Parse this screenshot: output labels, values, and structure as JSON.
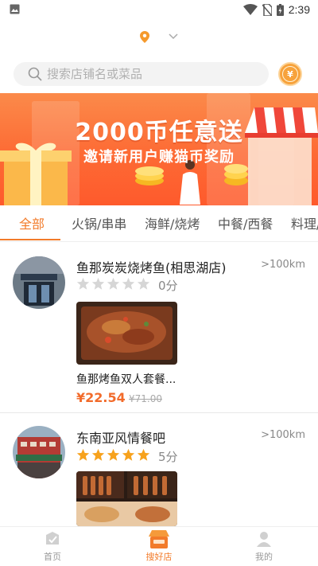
{
  "status_bar": {
    "time": "2:39"
  },
  "location": {
    "name": ""
  },
  "search": {
    "placeholder": "搜索店铺名或菜品",
    "coin_icon": "¥"
  },
  "banner": {
    "title": "2000币任意送",
    "subtitle": "邀请新用户赚猫币奖励"
  },
  "tabs": [
    {
      "label": "全部",
      "active": true
    },
    {
      "label": "火锅/串串",
      "active": false
    },
    {
      "label": "海鲜/烧烤",
      "active": false
    },
    {
      "label": "中餐/西餐",
      "active": false
    },
    {
      "label": "料理/",
      "active": false
    }
  ],
  "stores": [
    {
      "name": "鱼那炭炭烧烤鱼(相思湖店)",
      "distance": ">100km",
      "rating": 0,
      "score_text": "0分",
      "dish": {
        "name": "鱼那烤鱼双人套餐...",
        "price": "¥22.54",
        "old_price": "¥71.00"
      }
    },
    {
      "name": "东南亚风情餐吧",
      "distance": ">100km",
      "rating": 5,
      "score_text": "5分"
    }
  ],
  "bottom_nav": [
    {
      "label": "首页",
      "icon": "home-icon",
      "active": false
    },
    {
      "label": "搜好店",
      "icon": "shop-icon",
      "active": true
    },
    {
      "label": "我的",
      "icon": "profile-icon",
      "active": false
    }
  ],
  "colors": {
    "accent": "#f27b2a",
    "star_on": "#f7a21d",
    "star_off": "#d6d6d6",
    "banner": "#fd6a34"
  }
}
